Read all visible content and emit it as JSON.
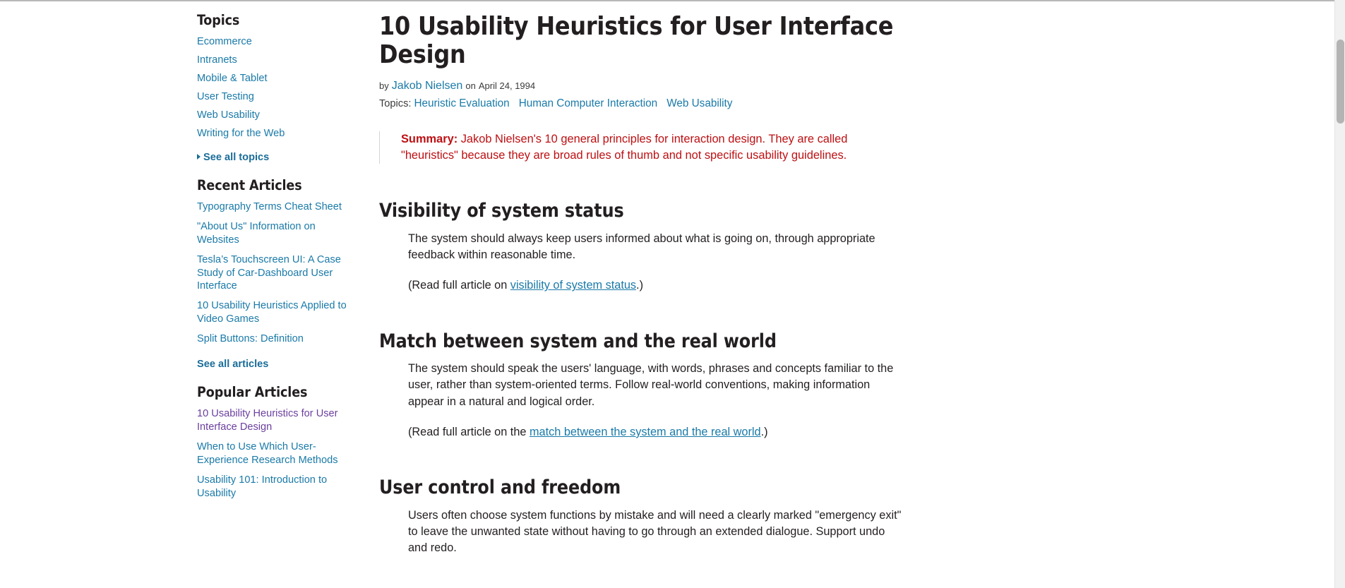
{
  "sidebar": {
    "topics_heading": "Topics",
    "topics": [
      "Ecommerce",
      "Intranets",
      "Mobile & Tablet",
      "User Testing",
      "Web Usability",
      "Writing for the Web"
    ],
    "see_all_topics": "See all topics",
    "recent_heading": "Recent Articles",
    "recent": [
      "Typography Terms Cheat Sheet",
      "\"About Us\" Information on Websites",
      "Tesla’s Touchscreen UI: A Case Study of Car-Dashboard User Interface",
      "10 Usability Heuristics Applied to Video Games",
      "Split Buttons: Definition"
    ],
    "see_all_articles": "See all articles",
    "popular_heading": "Popular Articles",
    "popular": [
      "10 Usability Heuristics for User Interface Design",
      "When to Use Which User-Experience Research Methods",
      "Usability 101: Introduction to Usability"
    ]
  },
  "article": {
    "title": "10 Usability Heuristics for User Interface Design",
    "by_prefix": "by",
    "author": "Jakob Nielsen",
    "on_text": "on",
    "date": "April 24, 1994",
    "topics_label": "Topics:",
    "topics": [
      "Heuristic Evaluation",
      "Human Computer Interaction",
      "Web Usability"
    ],
    "summary_label": "Summary:",
    "summary_text": " Jakob Nielsen's 10 general principles for interaction design. They are called \"heuristics\" because they are broad rules of thumb and not specific usability guidelines.",
    "heuristics": [
      {
        "heading": "Visibility of system status",
        "body": "The system should always keep users informed about what is going on, through appropriate feedback within reasonable time.",
        "read_prefix": "(Read full article on ",
        "read_link": "visibility of system status",
        "read_suffix": ".)"
      },
      {
        "heading": "Match between system and the real world",
        "body": "The system should speak the users' language, with words, phrases and concepts familiar to the user, rather than system-oriented terms. Follow real-world conventions, making information appear in a natural and logical order.",
        "read_prefix": "(Read full article on the ",
        "read_link": "match between the system and the real world",
        "read_suffix": ".)"
      },
      {
        "heading": "User control and freedom",
        "body": "Users often choose system functions by mistake and will need a clearly marked \"emergency exit\" to leave the unwanted state without having to go through an extended dialogue. Support undo and redo.",
        "read_prefix": "",
        "read_link": "",
        "read_suffix": ""
      }
    ]
  },
  "colors": {
    "link": "#1a7aa8",
    "visited_link": "#6b3f9e",
    "summary_text": "#bd1013",
    "body_text": "#231f20"
  }
}
